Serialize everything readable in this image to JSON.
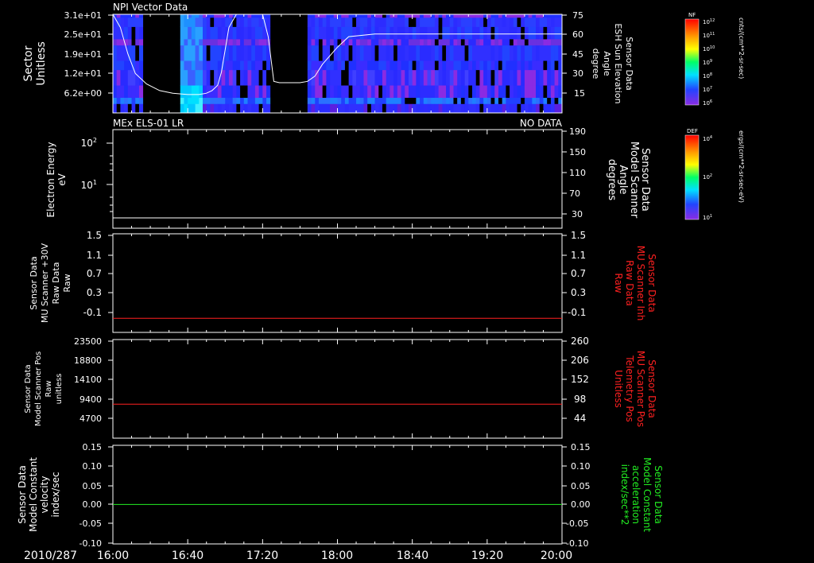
{
  "meta": {
    "date_label": "2010/287"
  },
  "time_axis": {
    "ticks": [
      "16:00",
      "16:40",
      "17:20",
      "18:00",
      "18:40",
      "19:20",
      "20:00"
    ],
    "start_min": 0,
    "end_min": 240
  },
  "panels": [
    {
      "id": "npi",
      "title_left": "NPI Vector Data",
      "title_right": "",
      "left_label": [
        "Sector",
        "Unitless"
      ],
      "left_ticks": [
        "3.1e+01",
        "2.5e+01",
        "1.9e+01",
        "1.2e+01",
        "6.2e+00"
      ],
      "right_label": [
        "Sensor Data",
        "ESH Sun Elevation",
        "Angle",
        "degree"
      ],
      "right_label_color": "#ffffff",
      "right_ticks": [
        "75",
        "60",
        "45",
        "30",
        "15"
      ]
    },
    {
      "id": "els",
      "title_left": "MEx ELS-01 LR",
      "title_right": "NO DATA",
      "left_label": [
        "Electron Energy",
        "eV"
      ],
      "left_ticks": [
        "10",
        "10"
      ],
      "left_tick_exps": [
        "2",
        "1"
      ],
      "right_label": [
        "Sensor Data",
        "Model Scanner",
        "Angle",
        "degrees"
      ],
      "right_label_color": "#ffffff",
      "right_ticks": [
        "190",
        "150",
        "110",
        "70",
        "30"
      ]
    },
    {
      "id": "mu_inh",
      "title_left": "",
      "title_right": "",
      "left_label": [
        "Sensor Data",
        "MU Scanner +30V",
        "Raw Data",
        "Raw"
      ],
      "left_ticks": [
        "1.5",
        "1.1",
        "0.7",
        "0.3",
        "-0.1"
      ],
      "right_label": [
        "Sensor Data",
        "MU Scanner Inh",
        "Raw Data",
        "Raw"
      ],
      "right_label_color": "#ff2020",
      "right_ticks": [
        "1.5",
        "1.1",
        "0.7",
        "0.3",
        "-0.1"
      ]
    },
    {
      "id": "scanner_pos",
      "title_left": "",
      "title_right": "",
      "left_label": [
        "Sensor Data",
        "Model Scanner Pos",
        "Raw",
        "unitless"
      ],
      "left_ticks": [
        "23500",
        "18800",
        "14100",
        "9400",
        "4700"
      ],
      "right_label": [
        "Sensor Data",
        "MU Scanner Pos",
        "Telemetry Pos",
        "Unitless"
      ],
      "right_label_color": "#ff2020",
      "right_ticks": [
        "260",
        "206",
        "152",
        "98",
        "44"
      ]
    },
    {
      "id": "velocity",
      "title_left": "",
      "title_right": "",
      "left_label": [
        "Sensor Data",
        "Model Constant",
        "velocity",
        "index/sec"
      ],
      "left_ticks": [
        "0.15",
        "0.10",
        "0.05",
        "0.00",
        "-0.05",
        "-0.10"
      ],
      "right_label": [
        "Sensor Data",
        "Model Constant",
        "acceleration",
        "index/sec**2"
      ],
      "right_label_color": "#22ee22",
      "right_ticks": [
        "0.15",
        "0.10",
        "0.05",
        "0.00",
        "-0.05",
        "-0.10"
      ]
    }
  ],
  "colorbars": [
    {
      "title": "NF",
      "units": "cnts/(cm**2-sr-sec)",
      "ticks": [
        "10",
        "10",
        "10",
        "10",
        "10",
        "10",
        "10"
      ],
      "tick_exps": [
        "12",
        "11",
        "10",
        "9",
        "8",
        "7",
        "6"
      ]
    },
    {
      "title": "DEF",
      "units": "ergs/(cm**2-sr-sec-eV)",
      "ticks": [
        "10",
        "10",
        "10"
      ],
      "tick_exps": [
        "4",
        "2",
        "1"
      ]
    }
  ],
  "chart_data": [
    {
      "type": "heatmap",
      "panel": "npi",
      "x_unit": "minutes since 16:00",
      "ylim": [
        0,
        32
      ],
      "gaps": [
        [
          15,
          35
        ],
        [
          84,
          104
        ]
      ],
      "sun_elevation_deg": {
        "x": [
          0,
          4,
          8,
          12,
          18,
          25,
          32,
          40,
          46,
          50,
          53,
          56,
          58,
          62,
          66,
          70,
          76,
          80,
          83,
          86,
          89,
          92,
          96,
          100,
          104,
          108,
          112,
          120,
          126,
          140,
          160,
          180,
          200,
          220,
          240
        ],
        "y": [
          75,
          65,
          45,
          30,
          22,
          17,
          15,
          14,
          14,
          15,
          17,
          21,
          31,
          65,
          75,
          75,
          75,
          75,
          58,
          24,
          23,
          23,
          23,
          23,
          24,
          28,
          37,
          50,
          58,
          60,
          60,
          60,
          60,
          60,
          60
        ],
        "ylim": [
          0,
          75
        ]
      }
    },
    {
      "type": "line",
      "panel": "els",
      "x": [
        0,
        240
      ],
      "y": [
        20,
        20
      ],
      "ylim": [
        0,
        190
      ]
    },
    {
      "type": "line",
      "panel": "mu_inh",
      "x": [
        0,
        240
      ],
      "y": [
        0.0,
        0.0
      ],
      "ylim": [
        -0.25,
        1.5
      ]
    },
    {
      "type": "line",
      "panel": "scanner_pos",
      "x": [
        0,
        240
      ],
      "y": [
        8100,
        8100
      ],
      "ylim": [
        0,
        23500
      ]
    },
    {
      "type": "line",
      "panel": "velocity",
      "x": [
        0,
        240
      ],
      "y": [
        0.0,
        0.0
      ],
      "ylim": [
        -0.1,
        0.15
      ]
    }
  ]
}
